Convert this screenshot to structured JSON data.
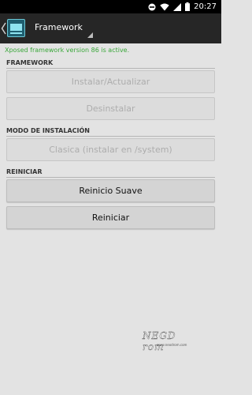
{
  "status_bar": {
    "time": "20:27",
    "icons": [
      "do-not-disturb-icon",
      "wifi-icon",
      "cellular-signal-icon",
      "battery-icon"
    ]
  },
  "action_bar": {
    "title": "Framework",
    "icons": [
      "back-caret-icon",
      "app-icon",
      "spinner-dropdown-icon"
    ]
  },
  "content": {
    "active_message": "Xposed framework version 86 is active.",
    "sections": {
      "framework": {
        "header": "FRAMEWORK",
        "install_button": "Instalar/Actualizar",
        "uninstall_button": "Desinstalar"
      },
      "install_mode": {
        "header": "MODO DE INSTALACIÓN",
        "mode_button": "Clasica (instalar en /system)"
      },
      "reboot": {
        "header": "REINICIAR",
        "soft_reboot_button": "Reinicio Suave",
        "reboot_button": "Reiniciar"
      }
    }
  },
  "watermark": {
    "brand": "NEGD rom",
    "url": "www.neodrom.com"
  },
  "colors": {
    "status_bar": "#000000",
    "action_bar": "#262626",
    "background": "#e3e3e3",
    "active_message": "#3aa73a",
    "enabled_text": "#111111",
    "disabled_text": "#adadad"
  }
}
